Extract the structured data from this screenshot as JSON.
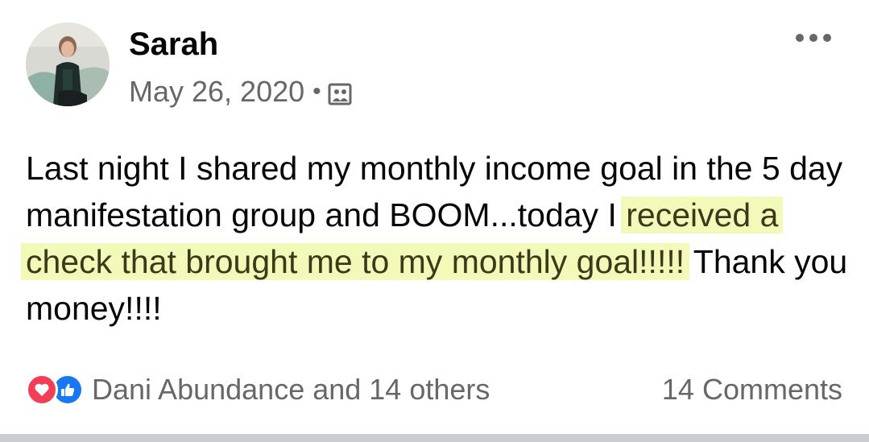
{
  "post": {
    "author": "Sarah",
    "date": "May 26, 2020",
    "separator": "•",
    "audience_icon": "photo-album-icon",
    "more_icon": "more-options-icon",
    "body": {
      "part1": "Last night I shared my monthly income goal in the 5 day manifestation group and BOOM...today I",
      "highlighted": "received a check that brought me to my monthly goal!!!!!",
      "part2": "Thank you money!!!!"
    }
  },
  "footer": {
    "reaction_icons": [
      "love-icon",
      "like-icon"
    ],
    "reactions_text": "Dani Abundance and 14 others",
    "comments_text": "14 Comments"
  },
  "colors": {
    "like_blue": "#1877f2",
    "love_red": "#f33e58",
    "secondary_text": "#65676b",
    "highlight": "#f3f9b9"
  }
}
